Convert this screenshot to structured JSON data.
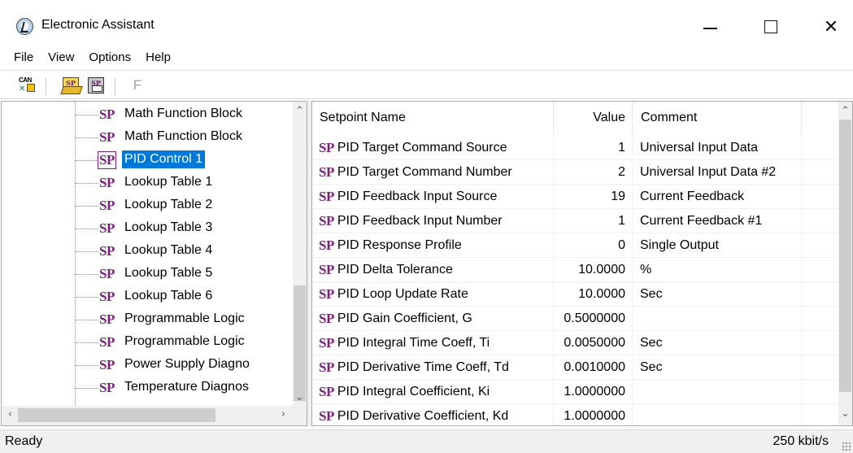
{
  "window": {
    "title": "Electronic Assistant"
  },
  "menu": [
    "File",
    "View",
    "Options",
    "Help"
  ],
  "toolbar": {
    "can_icon_text": "CAN",
    "sp_icon_text": "SP",
    "disabled_button_label": "F"
  },
  "tree": {
    "items": [
      {
        "badge": "SP",
        "label": "Math Function Block",
        "selected": false
      },
      {
        "badge": "SP",
        "label": "Math Function Block",
        "selected": false
      },
      {
        "badge": "SP",
        "label": "PID Control 1",
        "selected": true
      },
      {
        "badge": "SP",
        "label": "Lookup Table 1",
        "selected": false
      },
      {
        "badge": "SP",
        "label": "Lookup Table 2",
        "selected": false
      },
      {
        "badge": "SP",
        "label": "Lookup Table 3",
        "selected": false
      },
      {
        "badge": "SP",
        "label": "Lookup Table 4",
        "selected": false
      },
      {
        "badge": "SP",
        "label": "Lookup Table 5",
        "selected": false
      },
      {
        "badge": "SP",
        "label": "Lookup Table 6",
        "selected": false
      },
      {
        "badge": "SP",
        "label": "Programmable Logic",
        "selected": false
      },
      {
        "badge": "SP",
        "label": "Programmable Logic",
        "selected": false
      },
      {
        "badge": "SP",
        "label": "Power Supply Diagno",
        "selected": false
      },
      {
        "badge": "SP",
        "label": "Temperature Diagnos",
        "selected": false
      }
    ]
  },
  "table": {
    "headers": {
      "name": "Setpoint Name",
      "value": "Value",
      "comment": "Comment"
    },
    "rows": [
      {
        "badge": "SP",
        "name": "PID Target Command Source",
        "value": "1",
        "comment": "Universal Input Data"
      },
      {
        "badge": "SP",
        "name": "PID Target Command Number",
        "value": "2",
        "comment": "Universal Input Data #2"
      },
      {
        "badge": "SP",
        "name": "PID Feedback Input Source",
        "value": "19",
        "comment": "Current Feedback"
      },
      {
        "badge": "SP",
        "name": "PID Feedback Input Number",
        "value": "1",
        "comment": "Current Feedback #1"
      },
      {
        "badge": "SP",
        "name": "PID Response Profile",
        "value": "0",
        "comment": "Single Output"
      },
      {
        "badge": "SP",
        "name": "PID Delta Tolerance",
        "value": "10.0000",
        "comment": "%"
      },
      {
        "badge": "SP",
        "name": "PID Loop Update Rate",
        "value": "10.0000",
        "comment": "Sec"
      },
      {
        "badge": "SP",
        "name": "PID Gain Coefficient, G",
        "value": "0.5000000",
        "comment": ""
      },
      {
        "badge": "SP",
        "name": "PID Integral Time Coeff, Ti",
        "value": "0.0050000",
        "comment": "Sec"
      },
      {
        "badge": "SP",
        "name": "PID Derivative Time Coeff, Td",
        "value": "0.0010000",
        "comment": "Sec"
      },
      {
        "badge": "SP",
        "name": "PID Integral Coefficient, Ki",
        "value": "1.0000000",
        "comment": ""
      },
      {
        "badge": "SP",
        "name": "PID Derivative Coefficient, Kd",
        "value": "1.0000000",
        "comment": ""
      }
    ]
  },
  "status": {
    "left": "Ready",
    "right": "250 kbit/s"
  },
  "colors": {
    "sp_badge": "#7a1f7c",
    "selection": "#0078d7"
  }
}
